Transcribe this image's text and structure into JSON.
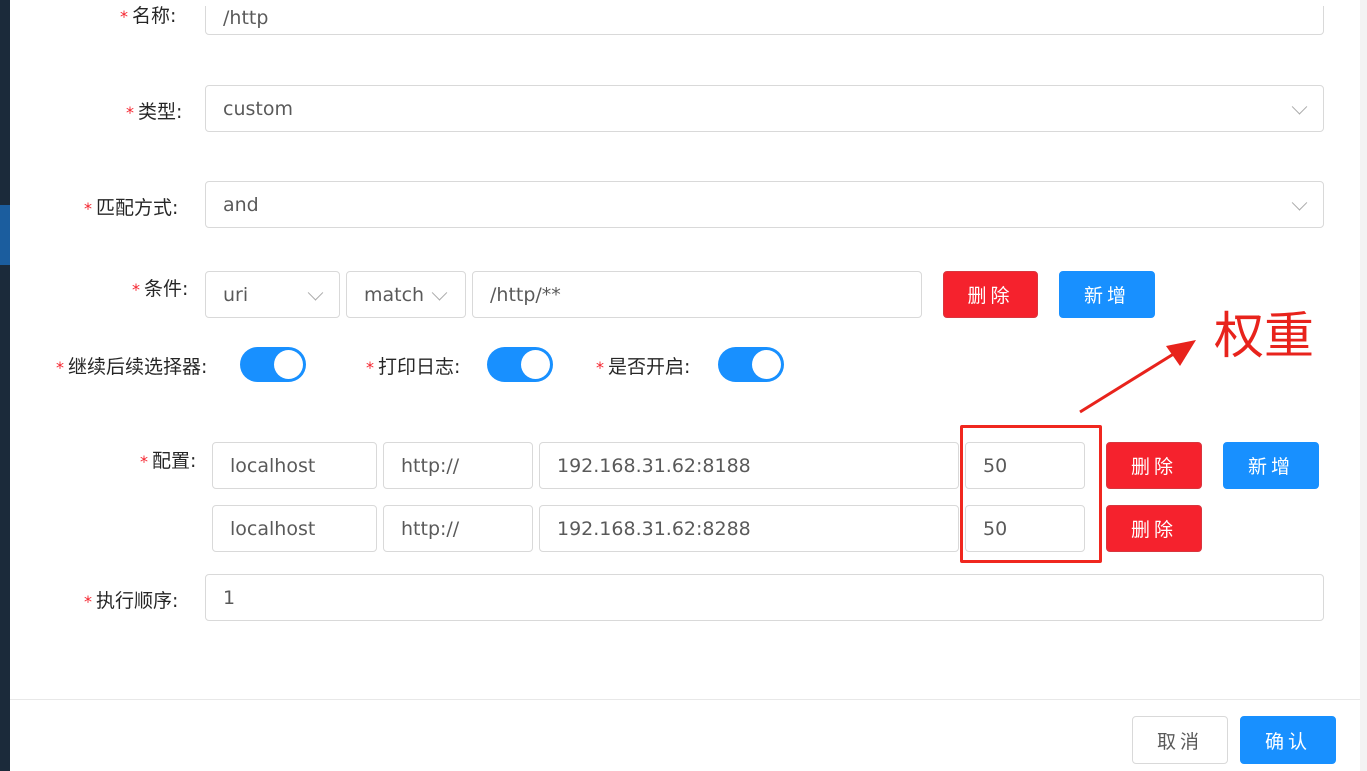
{
  "form": {
    "name": {
      "required_mark": "*",
      "label": "名称:",
      "value": "/http"
    },
    "type": {
      "required_mark": "*",
      "label": "类型:",
      "value": "custom"
    },
    "match_mode": {
      "required_mark": "*",
      "label": "匹配方式:",
      "value": "and"
    },
    "condition": {
      "required_mark": "*",
      "label": "条件:",
      "param_type": "uri",
      "operator": "match",
      "value": "/http/**",
      "delete_label": "删除",
      "add_label": "新增"
    },
    "switches": {
      "continue": {
        "required_mark": "*",
        "label": "继续后续选择器:",
        "checked": true
      },
      "log": {
        "required_mark": "*",
        "label": "打印日志:",
        "checked": true
      },
      "enabled": {
        "required_mark": "*",
        "label": "是否开启:",
        "checked": true
      }
    },
    "config": {
      "required_mark": "*",
      "label": "配置:",
      "rows": [
        {
          "host": "localhost",
          "protocol": "http://",
          "url": "192.168.31.62:8188",
          "weight": "50",
          "delete_label": "删除"
        },
        {
          "host": "localhost",
          "protocol": "http://",
          "url": "192.168.31.62:8288",
          "weight": "50",
          "delete_label": "删除"
        }
      ],
      "add_label": "新增"
    },
    "order": {
      "required_mark": "*",
      "label": "执行顺序:",
      "value": "1"
    }
  },
  "footer": {
    "cancel_label": "取消",
    "confirm_label": "确认"
  },
  "annotation": {
    "text": "权重",
    "color": "#e8231c"
  },
  "colors": {
    "primary": "#1890ff",
    "danger": "#f5222d",
    "required": "#f5222d"
  }
}
